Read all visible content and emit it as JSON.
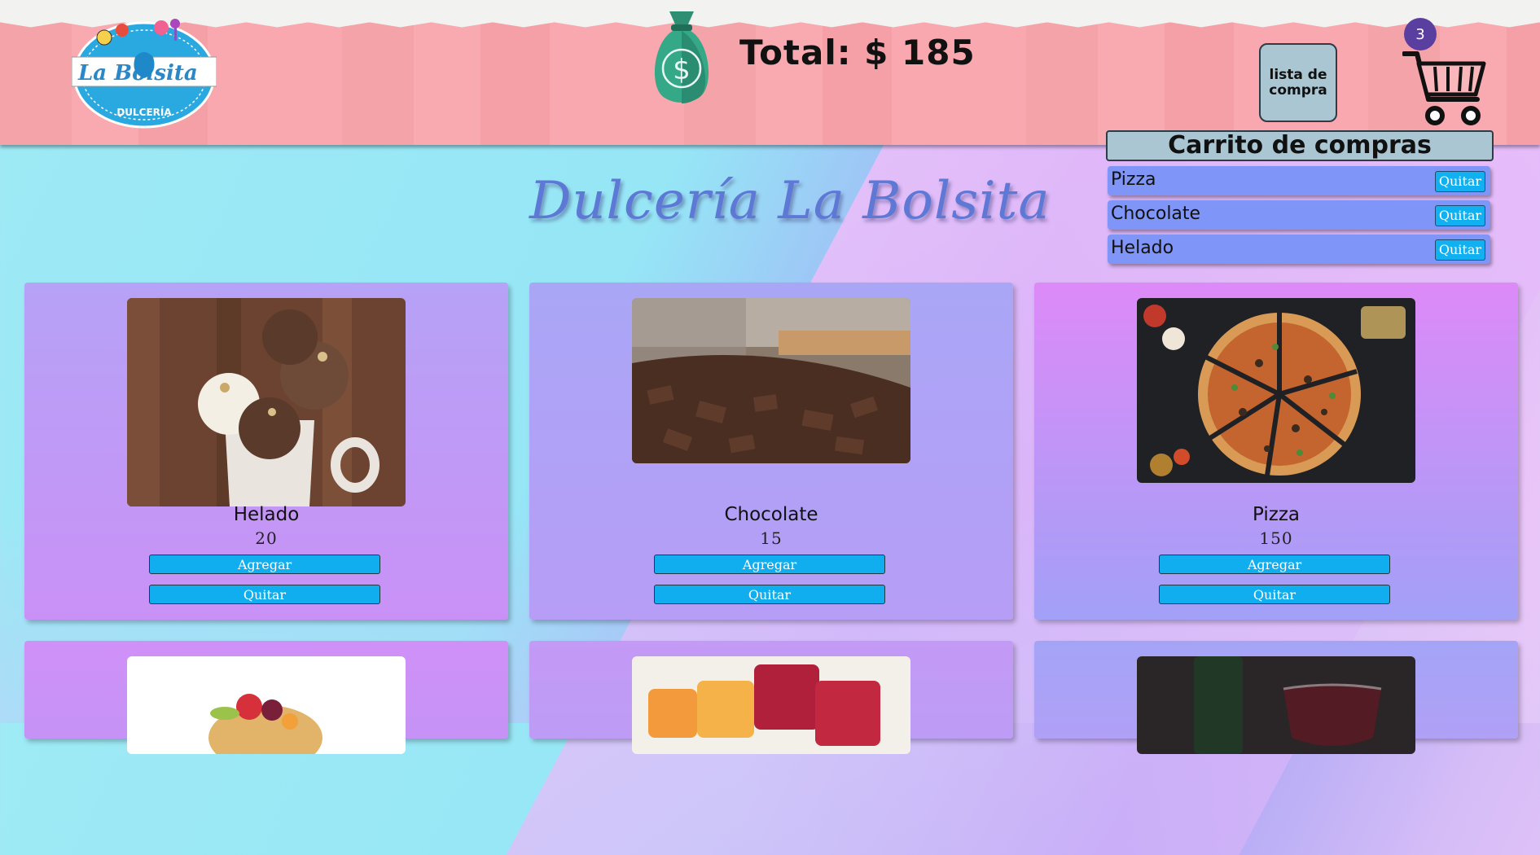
{
  "header": {
    "logo_text": "La Bolsita",
    "logo_subtext": "DULCERÍA",
    "total_label": "Total: $ 185",
    "list_button_label": "lista de compra",
    "cart_count": "3"
  },
  "cart": {
    "title": "Carrito de compras",
    "items": [
      {
        "name": "Pizza",
        "remove_label": "Quitar"
      },
      {
        "name": "Chocolate",
        "remove_label": "Quitar"
      },
      {
        "name": "Helado",
        "remove_label": "Quitar"
      }
    ]
  },
  "page_title": "Dulcería La Bolsita",
  "products": [
    {
      "name": "Helado",
      "price": "20",
      "add_label": "Agregar",
      "remove_label": "Quitar",
      "image": "ice-cream-photo"
    },
    {
      "name": "Chocolate",
      "price": "15",
      "add_label": "Agregar",
      "remove_label": "Quitar",
      "image": "chocolate-photo"
    },
    {
      "name": "Pizza",
      "price": "150",
      "add_label": "Agregar",
      "remove_label": "Quitar",
      "image": "pizza-photo"
    }
  ],
  "more_products": [
    {
      "image": "fruit-tart-photo"
    },
    {
      "image": "gummy-candy-photo"
    },
    {
      "image": "wine-photo"
    }
  ],
  "colors": {
    "header_pink": "#f4a3a8",
    "button_blue": "#10adef",
    "cart_row": "#7f95f7",
    "title_blue": "#5e78d6",
    "badge_purple": "#5a3fa0"
  }
}
